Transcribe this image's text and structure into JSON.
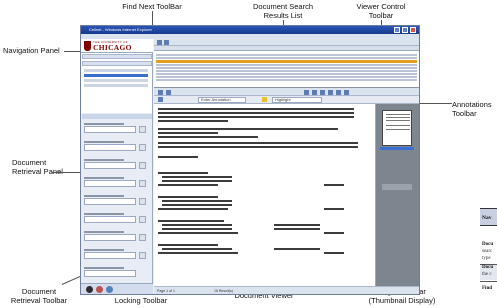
{
  "callouts": {
    "find_next_toolbar": "Find Next ToolBar",
    "document_search_results_list": "Document Search\nResults List",
    "viewer_control_toolbar": "Viewer Control\nToolbar",
    "navigation_panel": "Navigation Panel",
    "annotations_toolbar": "Annotations\nToolbar",
    "document_retrieval_panel": "Document\nRetrieval Panel",
    "document_retrieval_toolbar": "Document\nRetrieval Toolbar",
    "column_row_locking_toolbar": "Column/Row\nLocking Toolbar",
    "document_viewer": "Document Viewer",
    "pages_toolbar": "Pages Toolbar\n(Thumbnail Display)"
  },
  "screenshot": {
    "window_title": "Cellnet - Windows Internet Explorer",
    "logo_small": "THE UNIVERSITY OF",
    "logo_big": "CHICAGO",
    "annot_search": "Enter Annotation",
    "annot_highlight": "Highlight",
    "status_page": "Page 1 of 1",
    "status_results": "16 Result(s)"
  },
  "side_table": {
    "header": "Nav",
    "row1_a": "Docu",
    "row1_b": "searc",
    "row1_c": "type",
    "row2_a": "Docu",
    "row2_b": "the c",
    "row3_a": "Find"
  },
  "colors": {
    "title_bar": "#1f49a6",
    "logo_maroon": "#800000",
    "selection_blue": "#3b6fd1",
    "highlight_row": "#e0a020",
    "pages_panel": "#7d858f"
  }
}
